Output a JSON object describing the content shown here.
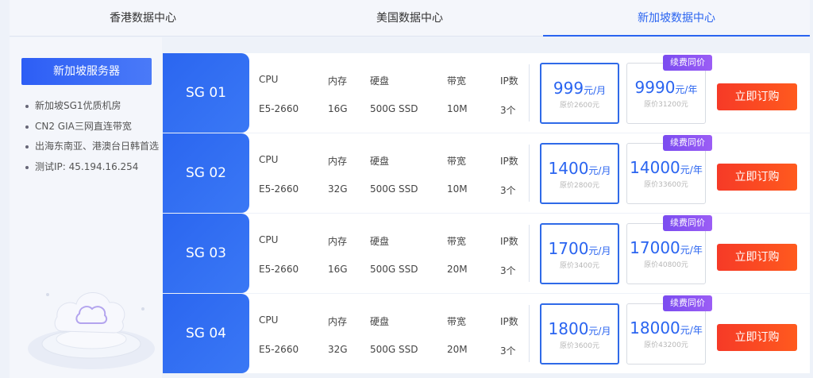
{
  "tabs": [
    {
      "label": "香港数据中心"
    },
    {
      "label": "美国数据中心"
    },
    {
      "label": "新加坡数据中心"
    }
  ],
  "sidebar": {
    "button_label": "新加坡服务器",
    "items": [
      {
        "text": "新加坡SG1优质机房"
      },
      {
        "text": "CN2 GIA三网直连带宽"
      },
      {
        "text": "出海东南亚、港澳台日韩首选"
      },
      {
        "text": "测试IP: 45.194.16.254"
      }
    ]
  },
  "spec_labels": {
    "cpu": "CPU",
    "ram": "内存",
    "disk": "硬盘",
    "bw": "带宽",
    "ip": "IP数"
  },
  "badge_label": "续费同价",
  "buy_label": "立即订购",
  "rows": [
    {
      "id": "SG 01",
      "cpu": "E5-2660",
      "ram": "16G",
      "disk": "500G SSD",
      "bw": "10M",
      "ip": "3个",
      "monthly": "999",
      "monthly_unit": "元/月",
      "monthly_orig": "原价2600元",
      "yearly": "9990",
      "yearly_unit": "元/年",
      "yearly_orig": "原价31200元"
    },
    {
      "id": "SG 02",
      "cpu": "E5-2660",
      "ram": "32G",
      "disk": "500G SSD",
      "bw": "10M",
      "ip": "3个",
      "monthly": "1400",
      "monthly_unit": "元/月",
      "monthly_orig": "原价2800元",
      "yearly": "14000",
      "yearly_unit": "元/年",
      "yearly_orig": "原价33600元"
    },
    {
      "id": "SG 03",
      "cpu": "E5-2660",
      "ram": "16G",
      "disk": "500G SSD",
      "bw": "20M",
      "ip": "3个",
      "monthly": "1700",
      "monthly_unit": "元/月",
      "monthly_orig": "原价3400元",
      "yearly": "17000",
      "yearly_unit": "元/年",
      "yearly_orig": "原价40800元"
    },
    {
      "id": "SG 04",
      "cpu": "E5-2660",
      "ram": "32G",
      "disk": "500G SSD",
      "bw": "20M",
      "ip": "3个",
      "monthly": "1800",
      "monthly_unit": "元/月",
      "monthly_orig": "原价3600元",
      "yearly": "18000",
      "yearly_unit": "元/年",
      "yearly_orig": "原价43200元"
    }
  ],
  "colors": {
    "accent": "#2a64f0",
    "buy": "#f63a27",
    "badge": "#8a55f2"
  }
}
